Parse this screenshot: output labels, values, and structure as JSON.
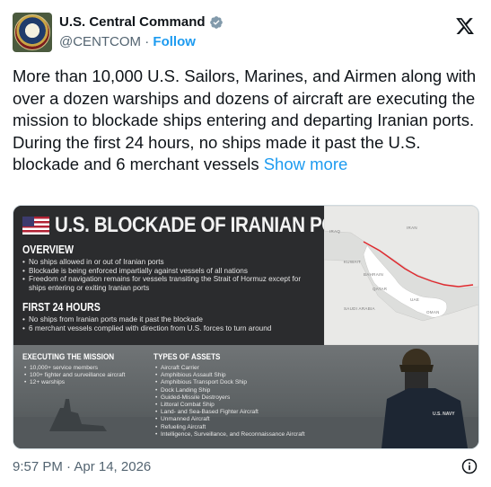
{
  "account": {
    "name": "U.S. Central Command",
    "handle": "@CENTCOM",
    "separator": "·",
    "follow_label": "Follow"
  },
  "icons": {
    "verified": "verified-badge-icon",
    "brand": "x-logo-icon",
    "info": "info-icon",
    "avatar": "centcom-seal"
  },
  "colors": {
    "accent": "#1d9bf0",
    "text": "#0f1419",
    "muted": "#536471"
  },
  "tweet": {
    "text": "More than 10,000 U.S. Sailors, Marines, and Airmen along with over a dozen warships and dozens of aircraft are executing the mission to blockade ships entering and departing Iranian ports. During the first 24 hours, no ships made it past the U.S. blockade and 6 merchant vessels",
    "show_more": "Show more",
    "timestamp": "9:57 PM · Apr 14, 2026"
  },
  "infographic": {
    "title": "U.S. BLOCKADE OF IRANIAN PORTS",
    "overview_heading": "OVERVIEW",
    "overview_items": [
      "No ships allowed in or out of Iranian ports",
      "Blockade is being enforced impartially against vessels of all nations",
      "Freedom of navigation remains for vessels transiting the Strait of Hormuz except for ships entering or exiting Iranian ports"
    ],
    "first24_heading": "FIRST 24 HOURS",
    "first24_items": [
      "No ships from Iranian ports made it past the blockade",
      "6 merchant vessels complied with direction from U.S. forces to turn around"
    ],
    "mission_heading": "EXECUTING THE MISSION",
    "mission_items": [
      "10,000+ service members",
      "100+ fighter and surveillance aircraft",
      "12+ warships"
    ],
    "assets_heading": "TYPES OF ASSETS",
    "assets_items": [
      "Aircraft Carrier",
      "Amphibious Assault Ship",
      "Amphibious Transport Dock Ship",
      "Dock Landing Ship",
      "Guided-Missile Destroyers",
      "Littoral Combat Ship",
      "Land- and Sea-Based Fighter Aircraft",
      "Unmanned Aircraft",
      "Refueling Aircraft",
      "Intelligence, Surveillance, and Reconnaissance Aircraft"
    ],
    "map_labels": {
      "iraq": "IRAQ",
      "iran": "IRAN",
      "kuwait": "KUWAIT",
      "bahrain": "BAHRAIN",
      "qatar": "QATAR",
      "uae": "UAE",
      "saudi": "SAUDI ARABIA",
      "oman": "OMAN"
    },
    "helmet_text": "U.S. NAVY"
  }
}
